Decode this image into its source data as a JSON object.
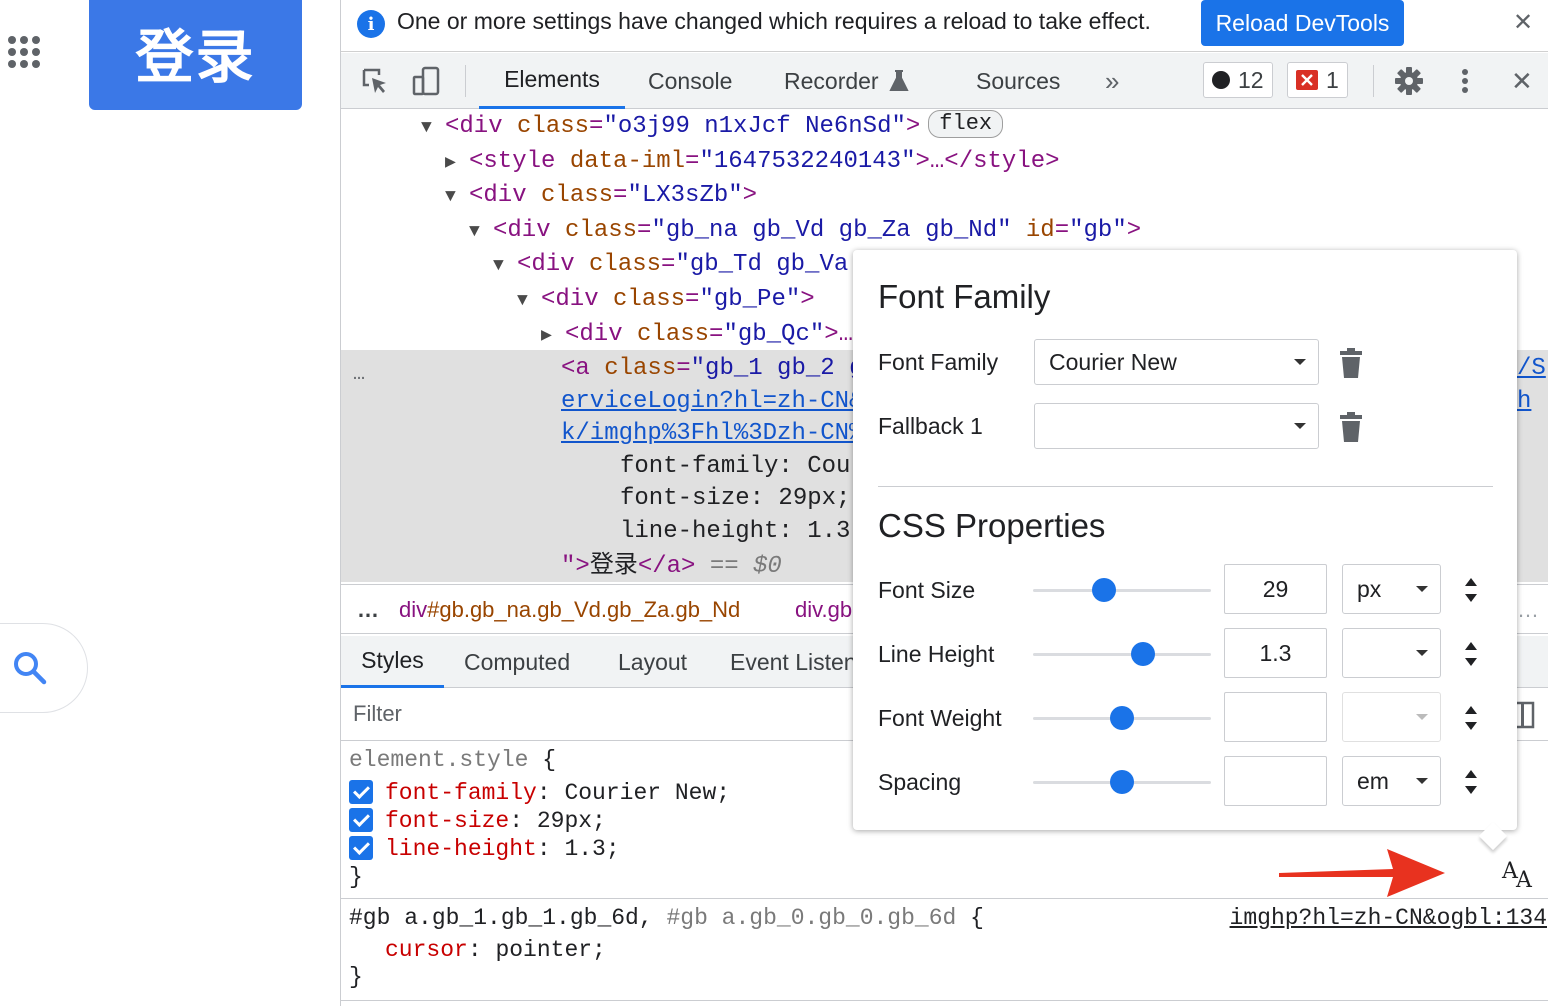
{
  "page": {
    "login_label": "登录"
  },
  "infobar": {
    "message": "One or more settings have changed which requires a reload to take effect.",
    "reload_label": "Reload DevTools",
    "close_glyph": "✕"
  },
  "toolbar": {
    "tabs": [
      "Elements",
      "Console",
      "Recorder",
      "Sources"
    ],
    "more_glyph": "»",
    "issues_count": "12",
    "errors_count": "1",
    "close_glyph": "✕"
  },
  "dom": {
    "line1": {
      "tag_open": "<div ",
      "attr": "class",
      "val": "\"o3j99 n1xJcf Ne6nSd\"",
      "close": ">",
      "badge": "flex"
    },
    "line2": {
      "tag_open": "<style ",
      "attr": "data-iml",
      "val": "\"1647532240143\"",
      "close": ">…</style>"
    },
    "line3": {
      "tag_open": "<div ",
      "attr": "class",
      "val": "\"LX3sZb\"",
      "close": ">"
    },
    "line4": {
      "tag_open": "<div ",
      "attr": "class",
      "val": "\"gb_na gb_Vd gb_Za gb_Nd\"",
      "attr2": "id",
      "val2": "\"gb\"",
      "close": ">"
    },
    "line5": {
      "tag_open": "<div ",
      "attr": "class",
      "val": "\"gb_Td gb_Va"
    },
    "line6": {
      "tag_open": "<div ",
      "attr": "class",
      "val": "\"gb_Pe\"",
      "close": ">"
    },
    "line7": {
      "tag_open": "<div ",
      "attr": "class",
      "val": "\"gb_Qc\"",
      "close": ">…"
    },
    "line8": {
      "tag_open": "<a ",
      "attr": "class",
      "val": "\"gb_1 gb_2 g"
    },
    "line9_link": "erviceLogin?hl=zh-CN&",
    "line10_link": "k/imghp%3Fhl%3Dzh-CN%",
    "line8_right": "/S",
    "line9_right": "h",
    "css1": "font-family: Cour",
    "css2": "font-size: 29px;",
    "css3": "line-height: 1.3",
    "line14_open": "\">",
    "line14_text": "登录",
    "line14_close": "</a>",
    "line14_eq": " == $0",
    "ellipsis": "…"
  },
  "breadcrumb": {
    "dots": "…",
    "item1_prefix": "div",
    "item1_rest": "#gb.gb_na.gb_Vd.gb_Za.gb_Nd",
    "item2": "div.gb",
    "right_ellipsis": "…"
  },
  "subtabs": [
    "Styles",
    "Computed",
    "Layout",
    "Event Listeners"
  ],
  "filter": {
    "placeholder": "Filter"
  },
  "styles": {
    "selector": "element.style",
    "open_brace": " {",
    "close_brace": "}",
    "decls": [
      {
        "prop": "font-family",
        "value": "Courier New;"
      },
      {
        "prop": "font-size",
        "value": "29px;"
      },
      {
        "prop": "line-height",
        "value": "1.3;"
      }
    ],
    "rule2_selector_a": "#gb a.gb_1.gb_1.gb_6d",
    "rule2_sep": ", ",
    "rule2_selector_b": "#gb a.gb_0.gb_0.gb_6d",
    "rule2_brace": " {",
    "rule2_prop": "cursor",
    "rule2_value": "pointer;",
    "rule2_source": "imghp?hl=zh-CN&ogbl:134"
  },
  "font_editor": {
    "title_family": "Font Family",
    "label_family": "Font Family",
    "family_value": "Courier New",
    "label_fallback": "Fallback 1",
    "fallback_value": "",
    "title_css": "CSS Properties",
    "rows": [
      {
        "label": "Font Size",
        "value": "29",
        "unit": "px",
        "slider": 0.4
      },
      {
        "label": "Line Height",
        "value": "1.3",
        "unit": "",
        "slider": 0.62
      },
      {
        "label": "Font Weight",
        "value": "",
        "unit": "",
        "slider": 0.5
      },
      {
        "label": "Spacing",
        "value": "",
        "unit": "em",
        "slider": 0.5
      }
    ],
    "toggle_glyph": "AA"
  },
  "colors": {
    "accent": "#1a73e8",
    "login_bg": "#3b78e7",
    "error_red": "#d93025",
    "arrow_red": "#e8321f"
  }
}
